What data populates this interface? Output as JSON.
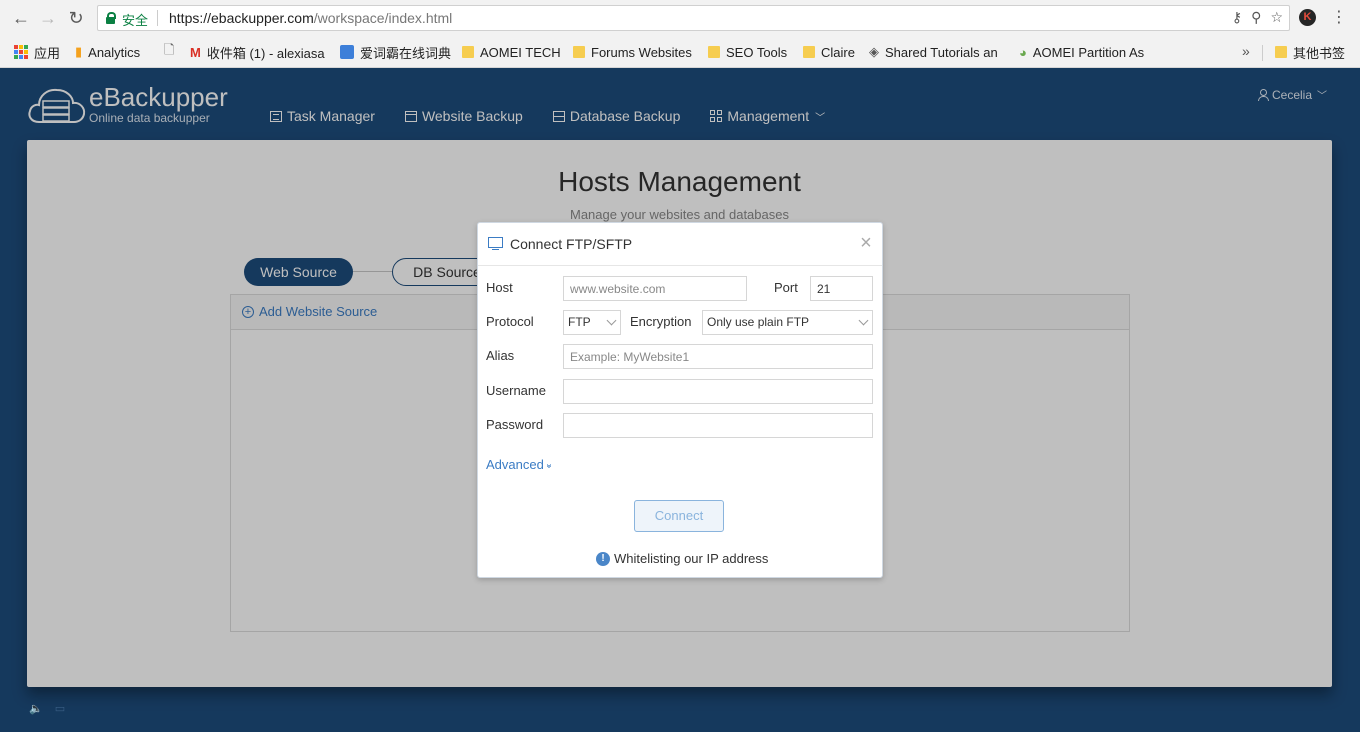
{
  "browser": {
    "secure_label": "安全",
    "url_host": "https://ebackupper.com",
    "url_path": "/workspace/index.html",
    "profile_initial": "K",
    "bookmarks": [
      {
        "label": "应用",
        "icon": "apps-icon"
      },
      {
        "label": "Analytics",
        "icon": "analytics-icon"
      },
      {
        "label": "",
        "icon": "page-icon"
      },
      {
        "label": "收件箱 (1) - alexiasa",
        "icon": "gmail-icon"
      },
      {
        "label": "爱词霸在线词典",
        "icon": "iciba-icon"
      },
      {
        "label": "AOMEI TECH",
        "icon": "folder-icon"
      },
      {
        "label": "Forums Websites",
        "icon": "folder-icon"
      },
      {
        "label": "SEO Tools",
        "icon": "folder-icon"
      },
      {
        "label": "Claire",
        "icon": "folder-icon"
      },
      {
        "label": "Shared Tutorials an",
        "icon": "shared-icon"
      },
      {
        "label": "AOMEI Partition As",
        "icon": "partition-icon"
      },
      {
        "label": "其他书签",
        "icon": "folder-icon"
      }
    ],
    "more_bookmarks": "»"
  },
  "app": {
    "brand_name": "eBackupper",
    "brand_tagline": "Online data backupper",
    "nav": [
      {
        "label": "Task Manager",
        "icon": "list-icon"
      },
      {
        "label": "Website Backup",
        "icon": "window-icon"
      },
      {
        "label": "Database Backup",
        "icon": "database-icon"
      },
      {
        "label": "Management",
        "icon": "grid-icon"
      }
    ],
    "user_name": "Cecelia"
  },
  "main": {
    "title": "Hosts Management",
    "subtitle": "Manage your websites and databases",
    "steps": [
      "Web Source",
      "DB Source"
    ],
    "add_source_label": "Add Website Source"
  },
  "dialog": {
    "title": "Connect FTP/SFTP",
    "host_label": "Host",
    "host_placeholder": "www.website.com",
    "port_label": "Port",
    "port_value": "21",
    "protocol_label": "Protocol",
    "protocol_value": "FTP",
    "encryption_label": "Encryption",
    "encryption_value": "Only use plain FTP",
    "alias_label": "Alias",
    "alias_placeholder": "Example: MyWebsite1",
    "username_label": "Username",
    "username_value": "",
    "password_label": "Password",
    "password_value": "",
    "advanced_label": "Advanced",
    "connect_label": "Connect",
    "whitelist_label": "Whitelisting our IP address"
  },
  "colors": {
    "brand_blue": "#1d4c7c",
    "link_blue": "#3b7cc4",
    "secure_green": "#0b8043"
  }
}
